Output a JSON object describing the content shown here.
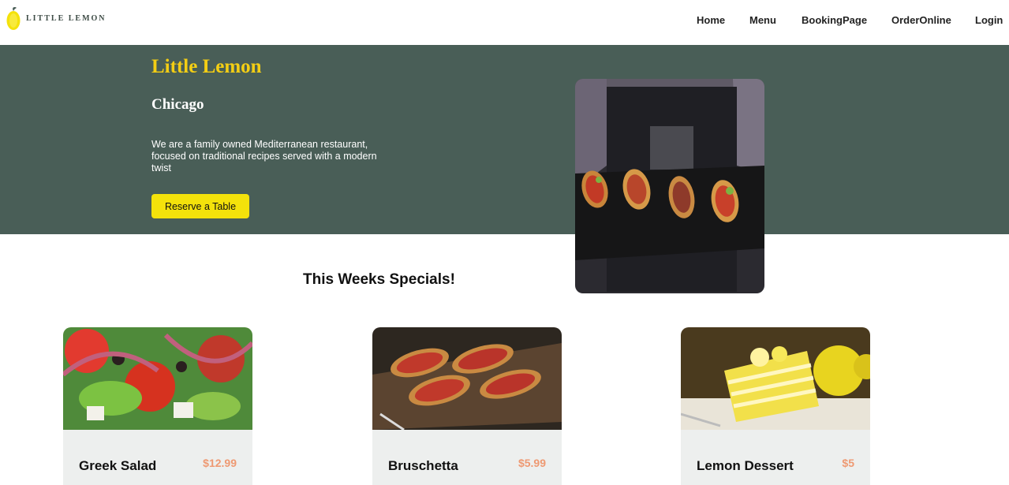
{
  "header": {
    "logo_text": "LITTLE LEMON",
    "nav": [
      "Home",
      "Menu",
      "BookingPage",
      "OrderOnline",
      "Login"
    ]
  },
  "hero": {
    "title": "Little Lemon",
    "subtitle": "Chicago",
    "description": "We are a family owned Mediterranean restaurant, focused on traditional recipes served with a modern twist",
    "button": "Reserve a Table"
  },
  "specials": {
    "title": "This Weeks Specials!",
    "items": [
      {
        "name": "Greek Salad",
        "price": "$12.99"
      },
      {
        "name": "Bruschetta",
        "price": "$5.99"
      },
      {
        "name": "Lemon Dessert",
        "price": "$5"
      }
    ]
  },
  "colors": {
    "primary_green": "#495e57",
    "primary_yellow": "#f4ce14",
    "button_yellow": "#f4e20b",
    "price_orange": "#ee9972",
    "card_bg": "#edefee"
  },
  "icons": {
    "logo": "lemon-icon"
  }
}
